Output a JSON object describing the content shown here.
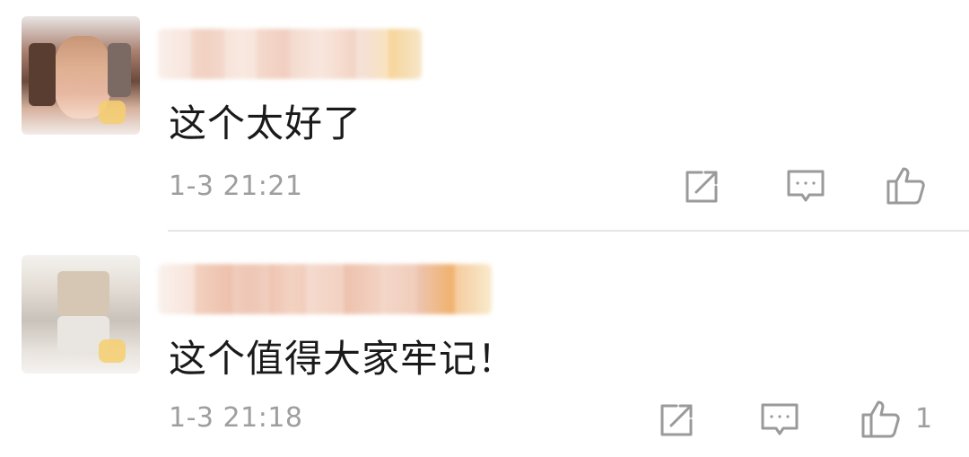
{
  "comments": [
    {
      "text": "这个太好了",
      "timestamp": "1-3 21:21",
      "like_count": "",
      "avatar": "avatar-image",
      "actions": {
        "share": "share-icon",
        "reply": "reply-icon",
        "like": "thumbs-up-icon"
      }
    },
    {
      "text": "这个值得大家牢记！",
      "timestamp": "1-3 21:18",
      "like_count": "1",
      "avatar": "avatar-image",
      "actions": {
        "share": "share-icon",
        "reply": "reply-icon",
        "like": "thumbs-up-icon"
      }
    }
  ],
  "colors": {
    "text": "#1a1a1a",
    "meta": "#9e9e9e",
    "icon": "#9a9a9a",
    "divider": "#e6e6e6"
  }
}
